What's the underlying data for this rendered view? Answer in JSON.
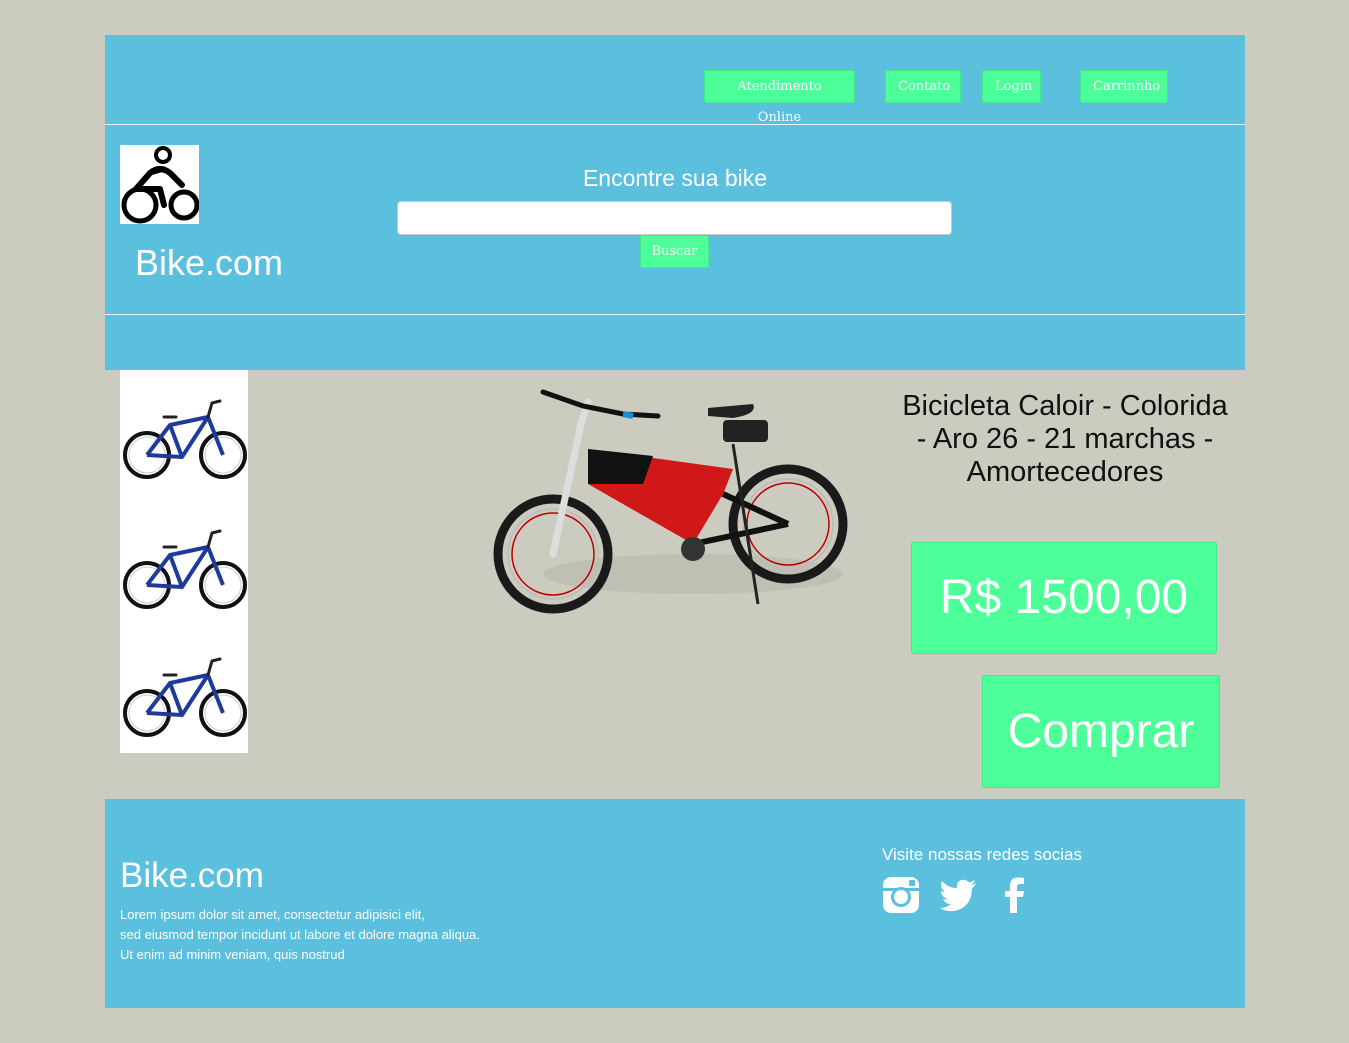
{
  "nav": {
    "atendimento": "Atendimento Online",
    "contato": "Contato",
    "login": "Login",
    "carrinho": "Carrinnho"
  },
  "header": {
    "brand": "Bike.com",
    "search_title": "Encontre sua bike",
    "search_placeholder": "",
    "search_button": "Buscar"
  },
  "product": {
    "title": "Bicicleta Caloir - Colorida - Aro 26 - 21 marchas - Amortecedores",
    "price": "R$ 1500,00",
    "buy_label": "Comprar"
  },
  "footer": {
    "brand": "Bike.com",
    "text_lines": [
      "Lorem ipsum dolor sit amet, consectetur adipisici elit,",
      "sed eiusmod tempor incidunt ut labore et dolore magna aliqua.",
      "Ut enim ad minim veniam, quis nostrud"
    ],
    "social_title": "Visite nossas redes socias"
  },
  "colors": {
    "primary": "#5bbfde",
    "accent": "#4dff99",
    "background": "#cccbc0"
  },
  "icons": [
    "cyclist-logo-icon",
    "instagram-icon",
    "twitter-icon",
    "facebook-icon"
  ]
}
